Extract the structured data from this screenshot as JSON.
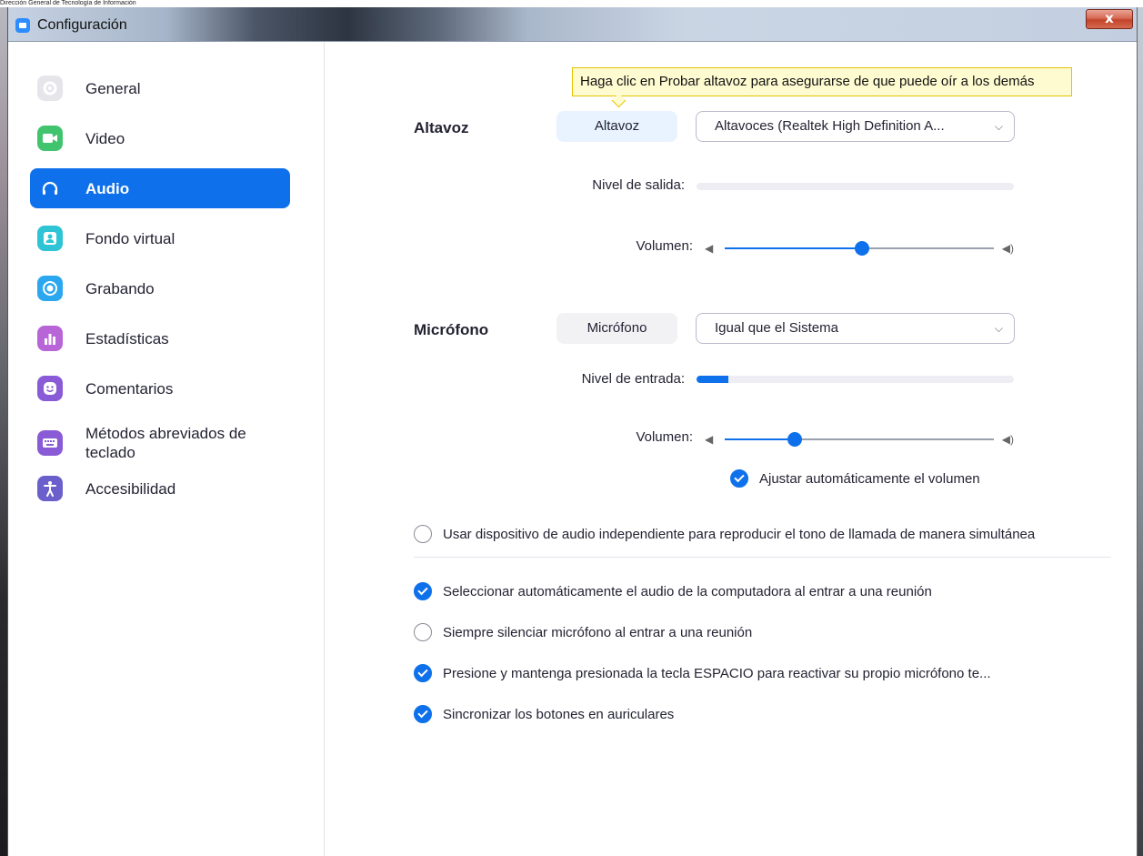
{
  "top_caption": "Dirección General de Tecnología de Información",
  "window": {
    "title": "Configuración",
    "close_label": "x"
  },
  "sidebar": {
    "items": [
      {
        "label": "General",
        "icon": "gear-icon",
        "color": "#e8e8ec",
        "active": false
      },
      {
        "label": "Video",
        "icon": "video-camera-icon",
        "color": "#42c46e",
        "active": false
      },
      {
        "label": "Audio",
        "icon": "headphones-icon",
        "color": "#0e71eb",
        "active": true
      },
      {
        "label": "Fondo virtual",
        "icon": "portrait-icon",
        "color": "#2ec4d6",
        "active": false
      },
      {
        "label": "Grabando",
        "icon": "record-icon",
        "color": "#2ba7f0",
        "active": false
      },
      {
        "label": "Estadísticas",
        "icon": "bar-chart-icon",
        "color": "#b865d8",
        "active": false
      },
      {
        "label": "Comentarios",
        "icon": "smiley-icon",
        "color": "#8a5bd6",
        "active": false
      },
      {
        "label": "Métodos abreviados de teclado",
        "icon": "keyboard-icon",
        "color": "#8a5bd6",
        "active": false
      },
      {
        "label": "Accesibilidad",
        "icon": "accessibility-icon",
        "color": "#6b5fcc",
        "active": false
      }
    ]
  },
  "tooltip": "Haga clic en Probar altavoz para asegurarse de que puede oír a los demás",
  "speaker": {
    "section_label": "Altavoz",
    "test_button": "Altavoz",
    "device": "Altavoces (Realtek High Definition A...",
    "output_level_label": "Nivel de salida:",
    "output_level": 0,
    "volume_label": "Volumen:",
    "volume": 0.51
  },
  "microphone": {
    "section_label": "Micrófono",
    "test_button": "Micrófono",
    "device": "Igual que el Sistema",
    "input_level_label": "Nivel de entrada:",
    "input_level": 0.1,
    "volume_label": "Volumen:",
    "volume": 0.26,
    "auto_adjust_label": "Ajustar automáticamente el volumen",
    "auto_adjust": true
  },
  "options": [
    {
      "label": "Usar dispositivo de audio independiente para reproducir el tono de llamada de manera simultánea",
      "checked": false
    },
    {
      "label": "Seleccionar automáticamente el audio de la computadora al entrar a una reunión",
      "checked": true
    },
    {
      "label": "Siempre silenciar micrófono al entrar a una reunión",
      "checked": false
    },
    {
      "label": "Presione y mantenga presionada la tecla ESPACIO para reactivar su propio micrófono te...",
      "checked": true
    },
    {
      "label": "Sincronizar los botones en auriculares",
      "checked": true
    }
  ]
}
